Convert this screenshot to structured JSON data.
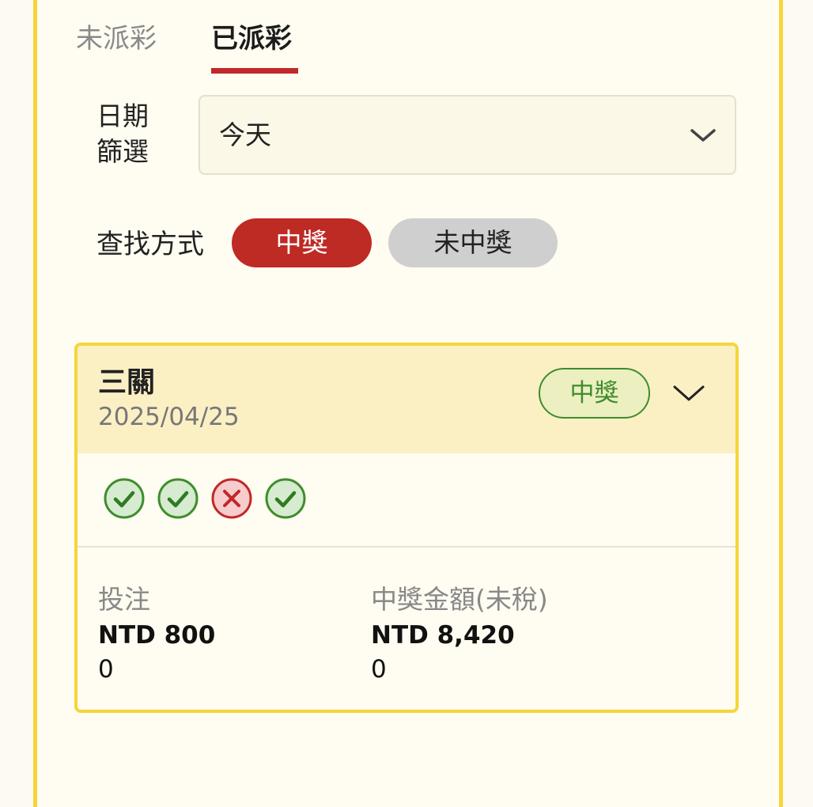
{
  "tabs": {
    "unsettled": "未派彩",
    "settled": "已派彩"
  },
  "date_filter": {
    "label": "日期篩選",
    "label_line1": "日期",
    "label_line2": "篩選",
    "value": "今天"
  },
  "find_mode": {
    "label": "查找方式",
    "options": [
      "中獎",
      "未中獎"
    ],
    "selected": "中獎"
  },
  "bet_card": {
    "bet_type": "三關",
    "date": "2025/04/25",
    "status": "中獎",
    "legs": [
      "win",
      "win",
      "lose",
      "win"
    ],
    "stake_label": "投注",
    "stake_amount": "NTD 800",
    "stake_extra": "0",
    "payout_label": "中獎金額(未稅)",
    "payout_amount": "NTD 8,420",
    "payout_extra": "0"
  },
  "colors": {
    "accent_red": "#be2a24",
    "border_yellow": "#f5d53a",
    "win_green": "#3e8d2e",
    "lose_red": "#c0282a"
  }
}
